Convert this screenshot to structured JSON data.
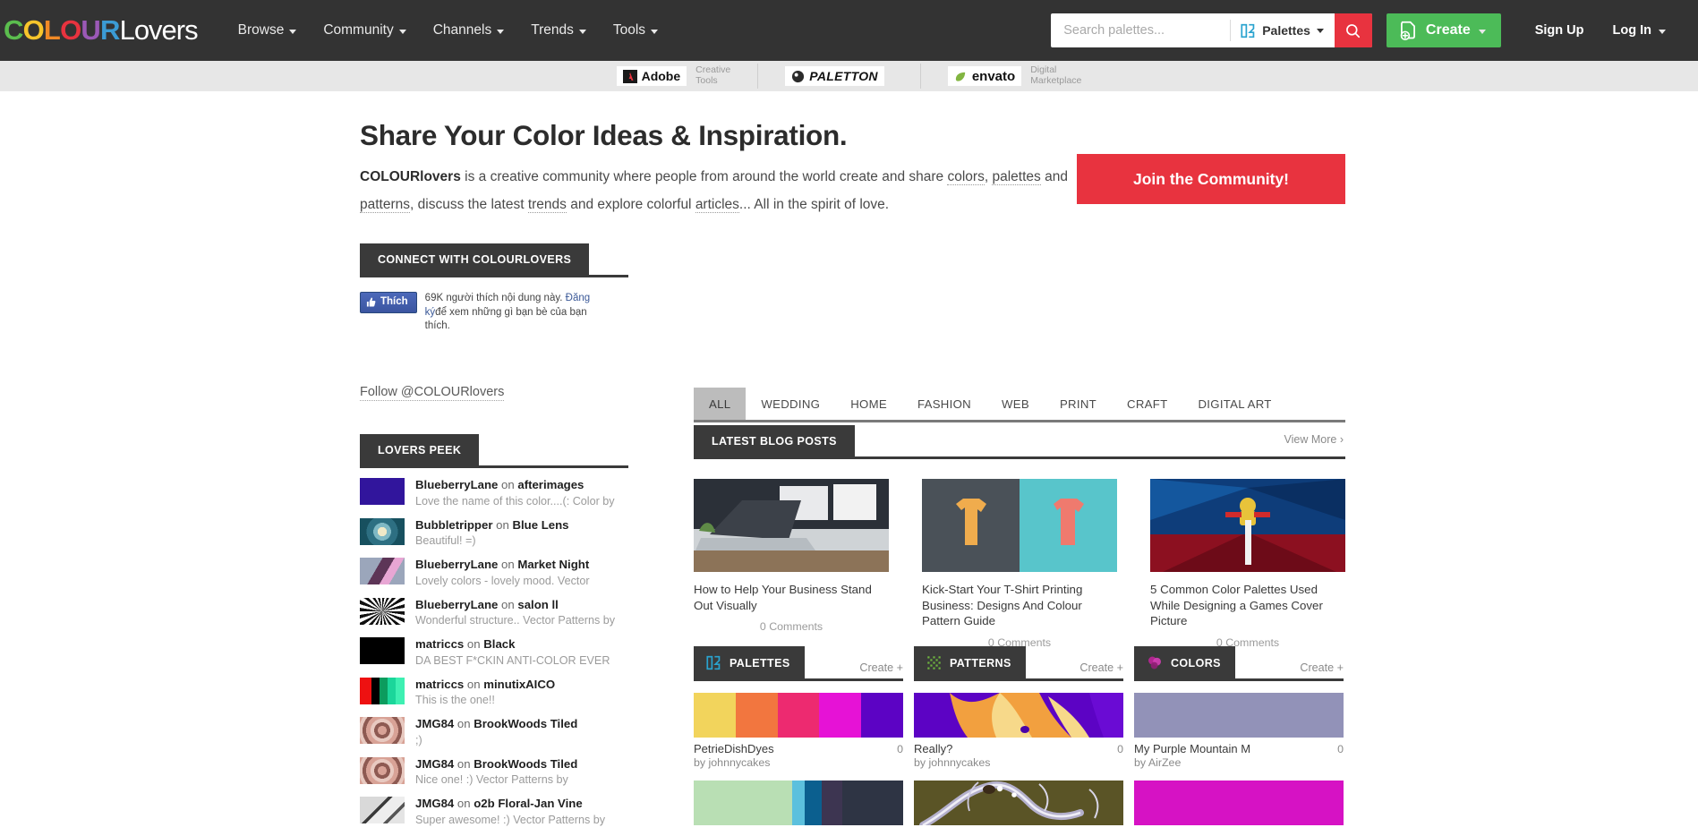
{
  "brand": {
    "logo_letters": [
      {
        "ch": "C",
        "color": "#5bbd4e"
      },
      {
        "ch": "O",
        "color": "#f7c52b"
      },
      {
        "ch": "L",
        "color": "#f08a26"
      },
      {
        "ch": "O",
        "color": "#e8333f"
      },
      {
        "ch": "U",
        "color": "#9b59b6"
      },
      {
        "ch": "R",
        "color": "#3b9bd4"
      }
    ],
    "logo_suffix": "Lovers",
    "accent_red": "#e8333f",
    "accent_green": "#4cbb58",
    "dark": "#333333"
  },
  "nav": {
    "items": [
      {
        "label": "Browse",
        "caret": true
      },
      {
        "label": "Community",
        "caret": true
      },
      {
        "label": "Channels",
        "caret": true
      },
      {
        "label": "Trends",
        "caret": true
      },
      {
        "label": "Tools",
        "caret": true
      }
    ],
    "search": {
      "placeholder": "Search palettes...",
      "value": "",
      "type_label": "Palettes",
      "search_icon": "magnifier-icon"
    },
    "create_label": "Create",
    "signup_label": "Sign Up",
    "login_label": "Log In"
  },
  "sponsors": [
    {
      "name": "Adobe",
      "sub": "Creative\nTools"
    },
    {
      "name": "PALETTON",
      "sub": ""
    },
    {
      "name": "envato",
      "sub": "Digital\nMarketplace"
    }
  ],
  "hero": {
    "title": "Share Your Color Ideas & Inspiration.",
    "para_1": "COLOURlovers",
    "para_2": " is a creative community where people from around the world create and share ",
    "link_colors": "colors",
    "para_3": ", ",
    "link_palettes": "palettes",
    "para_4": " and ",
    "link_patterns": "patterns",
    "para_5": ", discuss the latest ",
    "link_trends": "trends",
    "para_6": " and explore colorful ",
    "link_articles": "articles",
    "para_7": "... All in the spirit of love.",
    "join_label": "Join the Community!"
  },
  "connect": {
    "header": "CONNECT WITH COLOURLOVERS",
    "fb_like_label": "Thích",
    "fb_text_1": "69K người thích nội dung này. ",
    "fb_text_link": "Đăng ký",
    "fb_text_2": "để xem những gì bạn bè của bạn thích."
  },
  "follow": {
    "label": "Follow @COLOURlovers"
  },
  "peek": {
    "header": "LOVERS PEEK",
    "items": [
      {
        "user": "BlueberryLane",
        "on": " on ",
        "target": "afterimages",
        "comment": "Love the name of this color....(: Color by",
        "thumb_type": "solid",
        "thumb": "#31159c"
      },
      {
        "user": "Bubbletripper",
        "on": " on ",
        "target": "Blue Lens",
        "comment": "Beautiful! =)",
        "thumb_type": "pattern-floral-teal",
        "thumb": "#2d7f8e"
      },
      {
        "user": "BlueberryLane",
        "on": " on ",
        "target": "Market Night",
        "comment": "Lovely colors - lovely mood. Vector",
        "thumb_type": "pattern-purple",
        "thumb": "#9ba6bb"
      },
      {
        "user": "BlueberryLane",
        "on": " on ",
        "target": "salon ll",
        "comment": "Wonderful structure.. Vector Patterns by",
        "thumb_type": "pattern-starburst",
        "thumb": "#ffffff"
      },
      {
        "user": "matriccs",
        "on": " on ",
        "target": "Black",
        "comment": "DA BEST F*CKIN ANTI-COLOR EVER !!!!!!!",
        "thumb_type": "solid",
        "thumb": "#000000"
      },
      {
        "user": "matriccs",
        "on": " on ",
        "target": "minutixAICO",
        "comment": "This is the one!!",
        "thumb_type": "stripes",
        "thumb": "#ff0000"
      },
      {
        "user": "JMG84",
        "on": " on ",
        "target": "BrookWoods Tiled",
        "comment": ";)",
        "thumb_type": "pattern-damask",
        "thumb": "#d8a296"
      },
      {
        "user": "JMG84",
        "on": " on ",
        "target": "BrookWoods Tiled",
        "comment": "Nice one! :) Vector Patterns by",
        "thumb_type": "pattern-damask",
        "thumb": "#d8a296"
      },
      {
        "user": "JMG84",
        "on": " on ",
        "target": "o2b Floral-Jan Vine",
        "comment": "Super awesome! :) Vector Patterns by",
        "thumb_type": "pattern-vine",
        "thumb": "#cfcfcf"
      }
    ]
  },
  "categories": {
    "tabs": [
      {
        "label": "ALL",
        "active": true
      },
      {
        "label": "WEDDING",
        "active": false
      },
      {
        "label": "HOME",
        "active": false
      },
      {
        "label": "FASHION",
        "active": false
      },
      {
        "label": "WEB",
        "active": false
      },
      {
        "label": "PRINT",
        "active": false
      },
      {
        "label": "CRAFT",
        "active": false
      },
      {
        "label": "DIGITAL ART",
        "active": false
      }
    ]
  },
  "blog": {
    "header": "LATEST BLOG POSTS",
    "view_more": "View More ›",
    "posts": [
      {
        "title": "How to Help Your Business Stand Out Visually",
        "comments": "0 Comments",
        "thumb": "desk-laptop"
      },
      {
        "title": "Kick-Start Your T-Shirt Printing Business: Designs And Colour Pattern Guide",
        "comments": "0 Comments",
        "thumb": "tshirts"
      },
      {
        "title": "5 Common Color Palettes Used While Designing a Games Cover Picture",
        "comments": "0 Comments",
        "thumb": "game-cover"
      }
    ]
  },
  "columns": [
    {
      "id": "palettes",
      "title": "PALETTES",
      "icon": "palettes-icon",
      "icon_color": "#29a3cf",
      "create_label": "Create +",
      "items": [
        {
          "name": "PetrieDishDyes",
          "by": "by johnnycakes",
          "count": "0",
          "type": "swatches",
          "colors": [
            "#f2d45c",
            "#f2763f",
            "#ed2a70",
            "#e612d6",
            "#5c03c4"
          ]
        },
        {
          "name": "",
          "by": "",
          "count": "",
          "type": "swatches",
          "colors": [
            "#b9dfb4",
            "#5cc0dd",
            "#0b5f8f",
            "#3d3551",
            "#2e3444"
          ],
          "widths": [
            47,
            6,
            8,
            10,
            29
          ]
        }
      ]
    },
    {
      "id": "patterns",
      "title": "PATTERNS",
      "icon": "patterns-icon",
      "icon_color": "#6eb43f",
      "create_label": "Create +",
      "items": [
        {
          "name": "Really?",
          "by": "by johnnycakes",
          "count": "0",
          "type": "image",
          "thumb": "really-pattern",
          "colors": [
            "#5c03c4",
            "#f2a03f",
            "#f7d98a",
            "#8b2fc9"
          ]
        },
        {
          "name": "",
          "by": "",
          "count": "",
          "type": "image",
          "thumb": "olive-swirl",
          "colors": [
            "#5a5426",
            "#b4b0cc",
            "#ffffff",
            "#3a2a18"
          ]
        }
      ]
    },
    {
      "id": "colors",
      "title": "COLORS",
      "icon": "colors-icon",
      "icon_color": "#c0389b",
      "create_label": "Create +",
      "items": [
        {
          "name": "My Purple Mountain M",
          "by": "by AirZee",
          "count": "0",
          "type": "solid",
          "colors": [
            "#9292b8"
          ]
        },
        {
          "name": "",
          "by": "",
          "count": "",
          "type": "solid",
          "colors": [
            "#d612c4"
          ]
        }
      ]
    }
  ]
}
